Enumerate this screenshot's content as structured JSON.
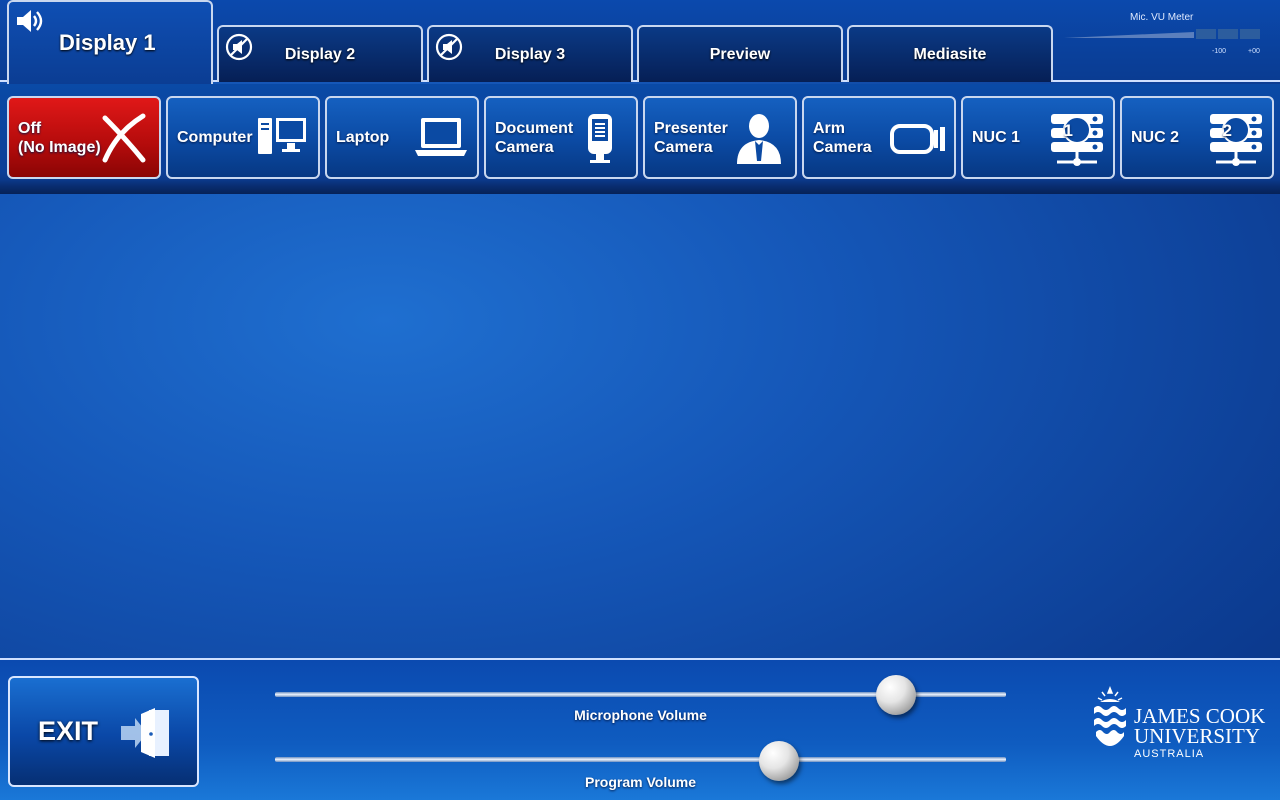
{
  "tabs": [
    {
      "label": "Display 1",
      "active": true,
      "icon": "speaker-icon"
    },
    {
      "label": "Display 2",
      "active": false,
      "icon": "muted-speaker-icon"
    },
    {
      "label": "Display 3",
      "active": false,
      "icon": "muted-speaker-icon"
    },
    {
      "label": "Preview",
      "active": false
    },
    {
      "label": "Mediasite",
      "active": false
    }
  ],
  "vu_meter": {
    "label": "Mic. VU Meter",
    "scale_min": "-100",
    "scale_max": "+00"
  },
  "sources": [
    {
      "label": "Off\n(No Image)",
      "icon": "x-mark-icon",
      "color": "#c40f0f"
    },
    {
      "label": "Computer",
      "icon": "desktop-computer-icon"
    },
    {
      "label": "Laptop",
      "icon": "laptop-icon"
    },
    {
      "label": "Document\nCamera",
      "icon": "document-camera-icon"
    },
    {
      "label": "Presenter\nCamera",
      "icon": "presenter-icon"
    },
    {
      "label": "Arm\nCamera",
      "icon": "video-camera-icon"
    },
    {
      "label": "NUC 1",
      "icon": "network-device-1-icon",
      "badge": "1"
    },
    {
      "label": "NUC 2",
      "icon": "network-device-2-icon",
      "badge": "2"
    }
  ],
  "exit": {
    "label": "EXIT",
    "icon": "exit-door-icon"
  },
  "sliders": {
    "microphone": {
      "label": "Microphone Volume",
      "level": 0.85
    },
    "program": {
      "label": "Program Volume",
      "level": 0.69
    }
  },
  "logo": {
    "line1": "JAMES COOK",
    "line2": "UNIVERSITY",
    "line3": "AUSTRALIA"
  },
  "colors": {
    "accent_blue": "#0b4aa3",
    "off_red": "#c40f0f",
    "border": "#c9d7ef"
  }
}
